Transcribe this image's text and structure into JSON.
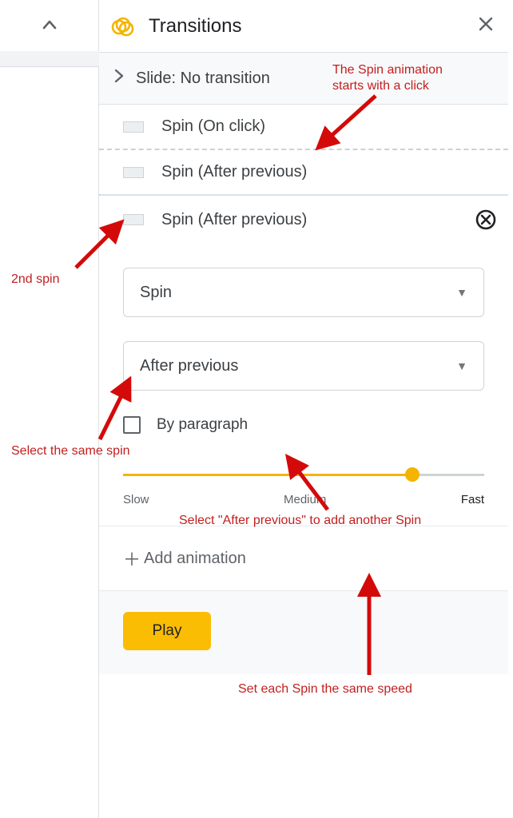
{
  "panel": {
    "title": "Transitions",
    "slide_section": {
      "label": "Slide: No transition"
    },
    "animations": [
      {
        "label": "Spin  (On click)"
      },
      {
        "label": "Spin  (After previous)"
      },
      {
        "label": "Spin  (After previous)"
      }
    ],
    "select_animation": "Spin",
    "select_trigger": "After previous",
    "by_paragraph_label": "By paragraph",
    "slider": {
      "slow": "Slow",
      "medium": "Medium",
      "fast": "Fast"
    },
    "add_animation_label": "Add animation",
    "play_label": "Play"
  },
  "annotations": {
    "top_click": "The Spin animation\nstarts with a click",
    "second_spin": "2nd spin",
    "select_same_spin": "Select the same spin",
    "after_previous": "Select \"After previous\" to add another Spin",
    "same_speed": "Set each Spin the same speed"
  }
}
